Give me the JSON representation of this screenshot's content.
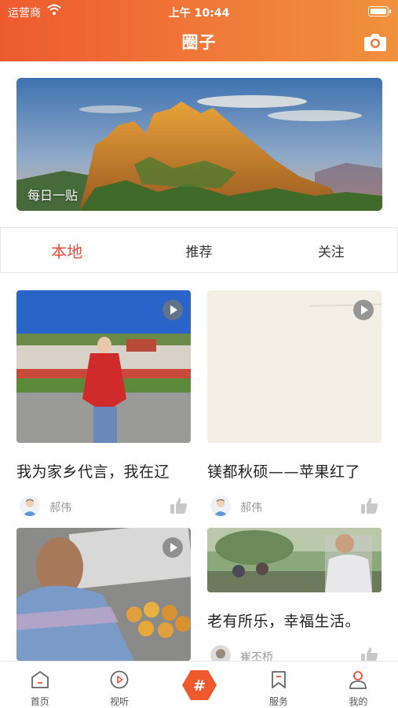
{
  "status_bar": {
    "carrier": "运营商",
    "time": "上午 10:44"
  },
  "header": {
    "title": "圈子"
  },
  "banner": {
    "caption": "每日一贴"
  },
  "tabs": [
    {
      "label": "本地",
      "active": true
    },
    {
      "label": "推荐",
      "active": false
    },
    {
      "label": "关注",
      "active": false
    }
  ],
  "posts": [
    {
      "title": "我为家乡代言，我在辽",
      "author": "郝伟",
      "video": true
    },
    {
      "title": "镁都秋硕——苹果红了",
      "author": "郝伟",
      "video": true
    },
    {
      "title": "",
      "author": "",
      "video": true
    },
    {
      "title": "老有所乐，幸福生活。",
      "author": "崔丕桥",
      "video": false
    }
  ],
  "bottom_nav": [
    {
      "label": "首页",
      "icon": "home-icon"
    },
    {
      "label": "视听",
      "icon": "play-circle-icon"
    },
    {
      "label": "",
      "icon": "hashtag-icon"
    },
    {
      "label": "服务",
      "icon": "bookmark-icon"
    },
    {
      "label": "我的",
      "icon": "profile-icon"
    }
  ],
  "colors": {
    "accent": "#ee4a3a",
    "header_start": "#ee5a2e",
    "header_end": "#f0913d"
  }
}
